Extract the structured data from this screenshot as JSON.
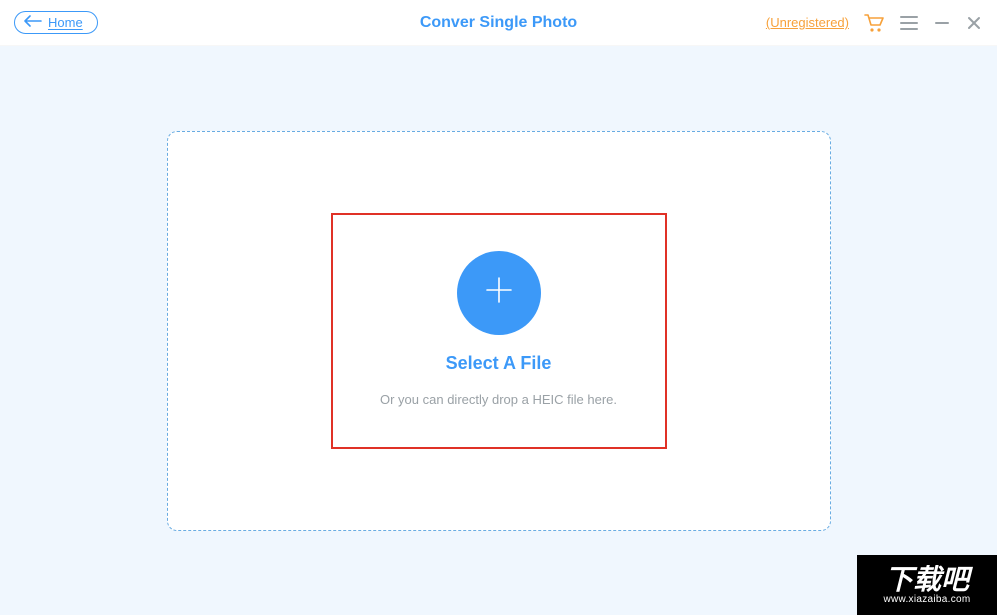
{
  "header": {
    "home_label": "Home",
    "title": "Conver Single Photo",
    "unregistered_label": "(Unregistered)"
  },
  "dropzone": {
    "select_title": "Select A File",
    "select_subtitle": "Or you can directly drop a HEIC file here."
  },
  "watermark": {
    "text": "下载吧",
    "url": "www.xiazaiba.com"
  },
  "colors": {
    "accent": "#3c99f8",
    "warn": "#f7a13a"
  }
}
